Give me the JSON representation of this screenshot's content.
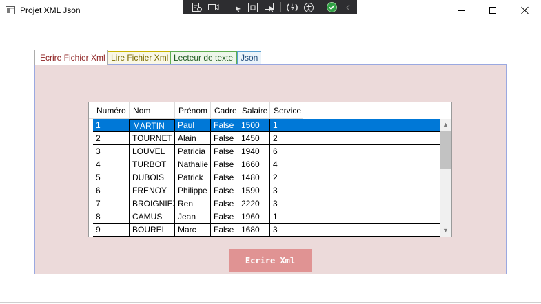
{
  "window": {
    "title": "Projet XML Json"
  },
  "debug_toolbar": {
    "icons": [
      "live-visual-tree-icon",
      "record-icon",
      "select-element-icon",
      "display-layout-adorners-icon",
      "track-focus-icon",
      "hot-reload-icon",
      "accessibility-icon",
      "check-icon",
      "collapse-icon"
    ],
    "colors": {
      "background": "#2d2d30",
      "check": "#2ea043"
    }
  },
  "tabs": [
    {
      "label": "Ecrire Fichier Xml",
      "selected": true
    },
    {
      "label": "Lire Fichier Xml",
      "selected": false
    },
    {
      "label": "Lecteur de texte",
      "selected": false
    },
    {
      "label": "Json",
      "selected": false
    }
  ],
  "grid": {
    "columns": [
      "Numéro",
      "Nom",
      "Prénom",
      "Cadre",
      "Salaire",
      "Service"
    ],
    "rows": [
      [
        "1",
        "MARTIN",
        "Paul",
        "False",
        "1500",
        "1"
      ],
      [
        "2",
        "TOURNET",
        "Alain",
        "False",
        "1450",
        "2"
      ],
      [
        "3",
        "LOUVEL",
        "Patricia",
        "False",
        "1940",
        "6"
      ],
      [
        "4",
        "TURBOT",
        "Nathalie",
        "False",
        "1660",
        "4"
      ],
      [
        "5",
        "DUBOIS",
        "Patrick",
        "False",
        "1480",
        "2"
      ],
      [
        "6",
        "FRENOY",
        "Philippe",
        "False",
        "1590",
        "3"
      ],
      [
        "7",
        "BROIGNIEZ",
        "Ren",
        "False",
        "2220",
        "3"
      ],
      [
        "8",
        "CAMUS",
        "Jean",
        "False",
        "1960",
        "1"
      ],
      [
        "9",
        "BOUREL",
        "Marc",
        "False",
        "1680",
        "3"
      ]
    ],
    "selected_row": 0,
    "scroll_position": 0.0
  },
  "action_button": {
    "label": "Ecrire Xml"
  },
  "colors": {
    "panel_background": "#ecdada",
    "selection": "#0078d7",
    "button": "#e09393"
  }
}
